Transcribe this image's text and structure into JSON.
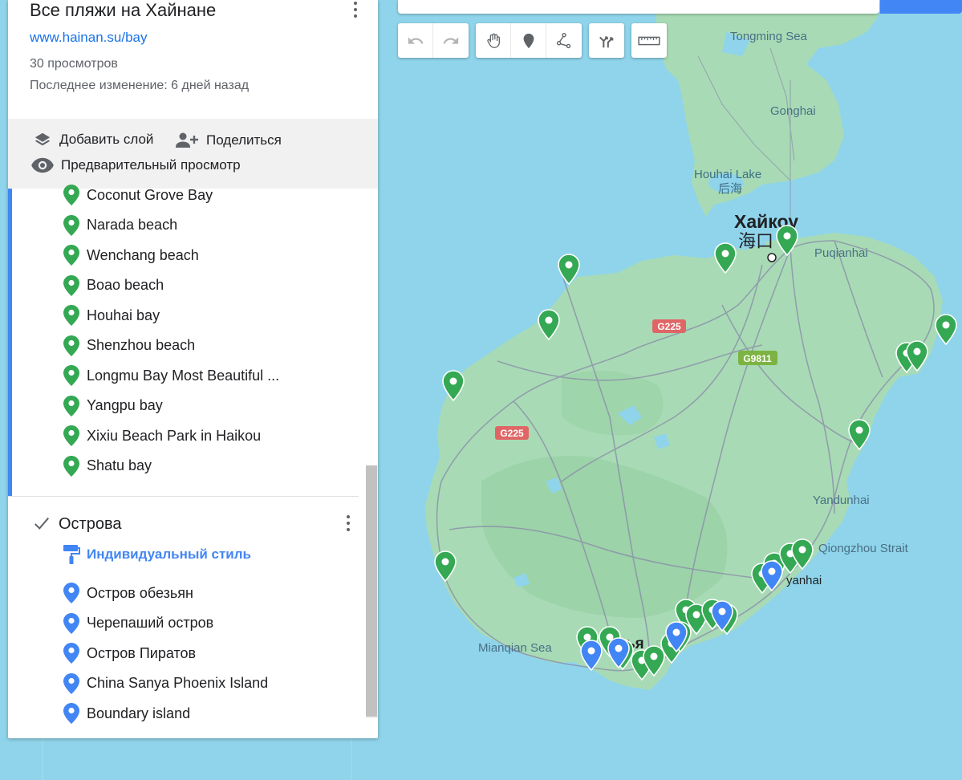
{
  "map": {
    "places": {
      "tongming_sea": "Tongming Sea",
      "gonghai": "Gonghai",
      "houhai_lake_en": "Houhai Lake",
      "houhai_lake_cn": "后海",
      "haikou_ru": "Хайкоу",
      "haikou_cn": "海口",
      "puqianhai": "Puqianhai",
      "yandunhai": "Yandunhai",
      "qiongzhou_strait": "Qiongzhou Strait",
      "mianqian_sea": "Mianqian Sea",
      "sanya_partial": "ья",
      "yanhai_partial": "yanhai",
      "haihai_partial": "hai"
    },
    "roads": {
      "g225": "G225",
      "g9811": "G9811"
    },
    "colors": {
      "water": "#8fd4ea",
      "land": "#a8dbb5",
      "road": "#8a8aa8",
      "pin_green": "#34a853",
      "pin_blue": "#4285f4"
    }
  },
  "toolbar": {
    "undo_icon": "undo-icon",
    "redo_icon": "redo-icon",
    "hand_icon": "hand-icon",
    "marker_icon": "marker-icon",
    "line_icon": "draw-line-icon",
    "directions_icon": "directions-icon",
    "ruler_icon": "ruler-icon"
  },
  "panel": {
    "title": "Все пляжи на Хайнане",
    "link": "www.hainan.su/bay",
    "views": "30 просмотров",
    "last_modified": "Последнее изменение: 6 дней назад",
    "add_layer": "Добавить слой",
    "share": "Поделиться",
    "preview": "Предварительный просмотр"
  },
  "beaches": [
    "Coconut Grove Bay",
    "Narada beach",
    "Wenchang beach",
    "Boao beach",
    "Houhai bay",
    "Shenzhou beach",
    "Longmu Bay Most Beautiful ...",
    "Yangpu bay",
    "Xixiu Beach Park in Haikou",
    "Shatu bay"
  ],
  "islands_layer": {
    "title": "Острова",
    "checked": true,
    "style_label": "Индивидуальный стиль",
    "items": [
      "Остров обезьян",
      "Черепаший остров",
      "Остров Пиратов",
      "China Sanya Phoenix Island",
      "Boundary island"
    ]
  }
}
